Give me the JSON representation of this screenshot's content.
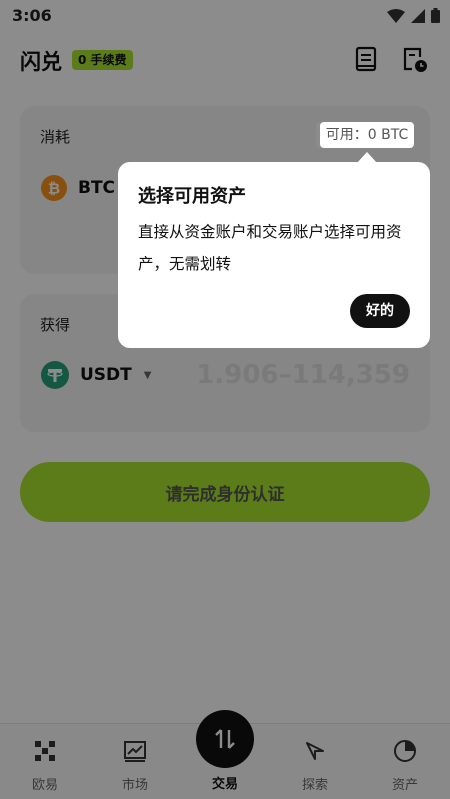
{
  "status_bar": {
    "time": "3:06"
  },
  "header": {
    "title": "闪兑",
    "fee_badge": "0 手续费"
  },
  "spend_card": {
    "label": "消耗",
    "available": "可用：0 BTC",
    "coin": "BTC"
  },
  "get_card": {
    "label": "获得",
    "coin": "USDT",
    "amount_placeholder": "1.906–114,359"
  },
  "verify_button": {
    "label": "请完成身份认证"
  },
  "bottom_nav": {
    "items": [
      {
        "label": "欧易",
        "icon": "okx-logo-icon"
      },
      {
        "label": "市场",
        "icon": "chart-icon"
      },
      {
        "label": "交易",
        "icon": "swap-icon"
      },
      {
        "label": "探索",
        "icon": "compass-icon"
      },
      {
        "label": "资产",
        "icon": "pie-chart-icon"
      }
    ]
  },
  "tooltip": {
    "title": "选择可用资产",
    "body": "直接从资金账户和交易账户选择可用资产，无需划转",
    "ok": "好的"
  },
  "colors": {
    "accent": "#a6e22e",
    "btc": "#f7931a",
    "usdt": "#26a17b"
  }
}
